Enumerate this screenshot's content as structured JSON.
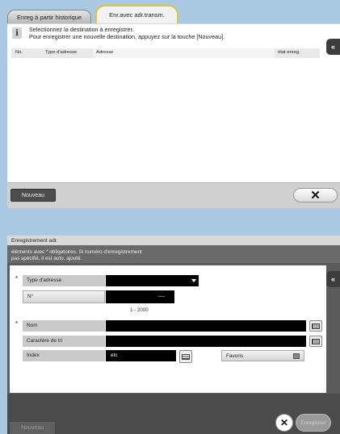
{
  "top": {
    "tabs": [
      {
        "label": "Enreg à partir historique"
      },
      {
        "label": "Enr.avec adr.transm."
      }
    ],
    "message_line1": "Selectionnez la destination à enregistrer.",
    "message_line2": "Pour enregistrer une nouvelle destination, appuyez sur la touche [Nouveau].",
    "columns": {
      "no": "No.",
      "type": "Type d'adresse",
      "adresse": "Adresse",
      "etat": "état enreg."
    },
    "back_icon": "«",
    "nouveau_label": "Nouveau",
    "close_icon": "✕"
  },
  "dialog": {
    "title": "Enregistrement adr.",
    "desc_line1": "éléments avec * obligatoires. Si numéro d'enregistrement",
    "desc_line2": "pas spécifié, il est auto. ajouté.",
    "star": "*",
    "type_label": "Type d'adresse",
    "type_value": "",
    "no_label": "N°",
    "no_value": "----",
    "no_range": "1 - 2000",
    "nom_label": "Nom",
    "nom_value": "",
    "tri_label": "Caractère de tri",
    "tri_value": "",
    "index_label": "Index",
    "index_value": "etc",
    "favoris_label": "Favoris",
    "back_icon": "«",
    "nouveau_label": "Nouveau",
    "close_icon": "✕",
    "enregistrer_label": "Enregistrer"
  },
  "colors": {
    "tab_active_border": "#e0c43a",
    "panel_bg": "#a9c8e2",
    "dialog_bg": "#5b5b5b"
  }
}
